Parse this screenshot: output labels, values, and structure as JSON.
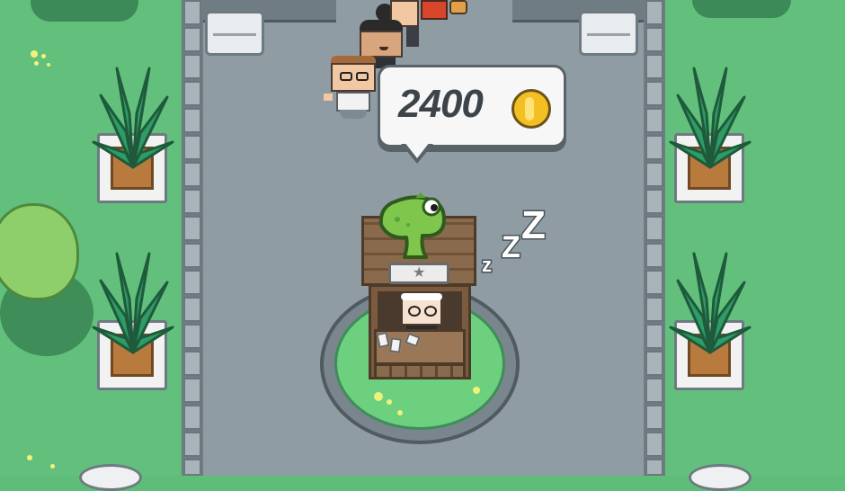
{
  "hud": {
    "coin_amount": "2400",
    "coin_icon": "gold-coin-icon"
  },
  "sleep": {
    "letters": [
      "z",
      "Z",
      "Z"
    ]
  },
  "colors": {
    "grass": "#62c07c",
    "road": "#8f9ca3",
    "bubble": "#f7f7f7",
    "coin": "#f3bf22",
    "dino": "#7fc64d"
  }
}
